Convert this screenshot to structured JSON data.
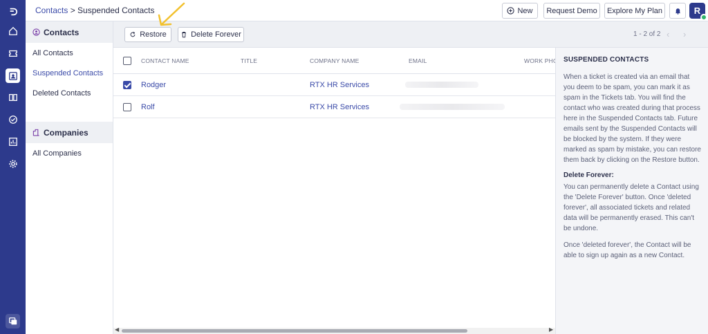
{
  "rail": {
    "items": [
      {
        "icon": "logo-icon"
      },
      {
        "icon": "home-icon"
      },
      {
        "icon": "ticket-icon"
      },
      {
        "icon": "contacts-icon",
        "active": true
      },
      {
        "icon": "knowledge-base-icon"
      },
      {
        "icon": "tasks-icon"
      },
      {
        "icon": "reports-icon"
      },
      {
        "icon": "settings-icon"
      },
      {
        "icon": "chat-icon"
      }
    ]
  },
  "header": {
    "breadcrumb_root": "Contacts",
    "breadcrumb_separator": " > ",
    "breadcrumb_current": "Suspended Contacts",
    "new_label": "New",
    "request_demo_label": "Request Demo",
    "explore_plan_label": "Explore My Plan",
    "avatar_initial": "R"
  },
  "sidebar": {
    "contacts_heading": "Contacts",
    "contacts_items": [
      "All Contacts",
      "Suspended Contacts",
      "Deleted Contacts"
    ],
    "companies_heading": "Companies",
    "companies_items": [
      "All Companies"
    ]
  },
  "toolbar": {
    "restore_label": "Restore",
    "delete_forever_label": "Delete Forever",
    "pagination": "1 - 2 of 2"
  },
  "table": {
    "columns": [
      "CONTACT NAME",
      "TITLE",
      "COMPANY NAME",
      "EMAIL",
      "WORK PHONE"
    ],
    "rows": [
      {
        "name": "Rodger",
        "title": "",
        "company": "RTX HR Services",
        "checked": true
      },
      {
        "name": "Rolf",
        "title": "",
        "company": "RTX HR Services",
        "checked": false
      }
    ]
  },
  "info": {
    "heading": "SUSPENDED CONTACTS",
    "paragraph1": "When a ticket is created via an email that you deem to be spam, you can mark it as spam in the Tickets tab. You will find the contact who was created during that process here in the Suspended Contacts tab. Future emails sent by the Suspended Contacts will be blocked by the system. If they were marked as spam by mistake, you can restore them back by clicking on the Restore button.",
    "subheading": "Delete Forever:",
    "paragraph2": "You can permanently delete a Contact using the 'Delete Forever' button. Once 'deleted forever', all associated tickets and related data will be permanently erased. This can't be undone.",
    "paragraph3": "Once 'deleted forever', the Contact will be able to sign up again as a new Contact."
  },
  "colors": {
    "rail": "#2d3a8c",
    "accent": "#3a4aa8",
    "annotation_arrow": "#f2c12e",
    "online": "#2fb36a"
  }
}
